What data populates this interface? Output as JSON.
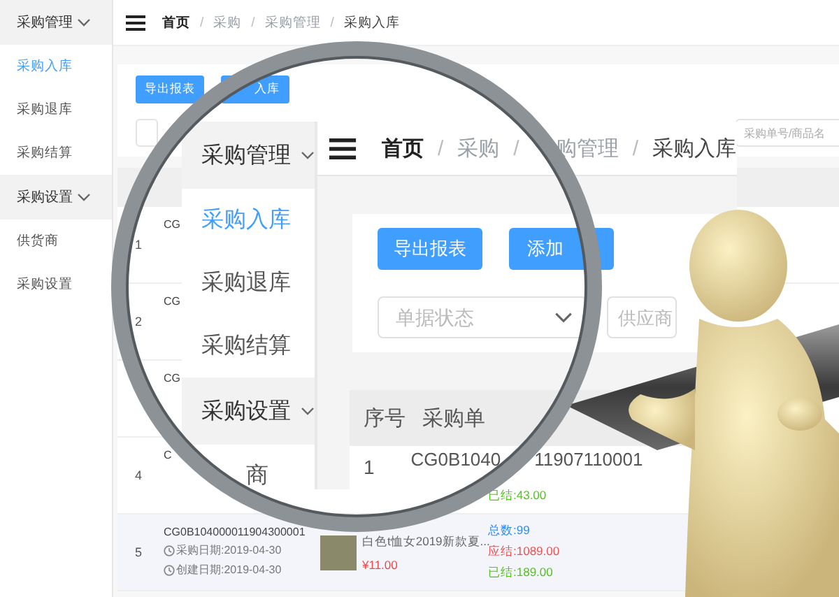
{
  "sidebar": {
    "groups": [
      {
        "label": "采购管理",
        "expanded": true,
        "items": [
          {
            "label": "采购入库",
            "selected": true
          },
          {
            "label": "采购退库",
            "selected": false
          },
          {
            "label": "采购结算",
            "selected": false
          }
        ]
      },
      {
        "label": "采购设置",
        "expanded": true,
        "items": [
          {
            "label": "供货商",
            "selected": false
          },
          {
            "label": "采购设置",
            "selected": false
          }
        ]
      }
    ]
  },
  "breadcrumb": {
    "separator": "/",
    "items": [
      "首页",
      "采购",
      "采购管理",
      "采购入库"
    ]
  },
  "buttons": [
    "导出报表",
    "入库"
  ],
  "search": {
    "placeholder": "采购单号/商品名"
  },
  "table": {
    "rows": [
      {
        "index": "1",
        "order_no": "CG",
        "highlighted": false
      },
      {
        "index": "2",
        "order_no": "CG",
        "highlighted": false
      },
      {
        "order_no": "CG",
        "highlighted": false
      },
      {
        "index": "4",
        "order_no": "C",
        "highlighted": false,
        "totals": [
          {
            "kind": "settled",
            "text": "已结:43.00"
          }
        ]
      },
      {
        "index": "5",
        "order_no": "CG0B104000011904300001",
        "highlighted": true,
        "dates": [
          "采购日期:2019-04-30",
          "创建日期:2019-04-30"
        ],
        "product": {
          "name": "白色t恤女2019新款夏...",
          "price": "¥11.00"
        },
        "totals": [
          {
            "kind": "total",
            "text": "总数:99"
          },
          {
            "kind": "payable",
            "text": "应结:1089.00"
          },
          {
            "kind": "settled",
            "text": "已结:189.00"
          }
        ]
      }
    ]
  },
  "magnifier": {
    "sidebar": {
      "groups": [
        {
          "label": "采购管理",
          "expanded": true,
          "items": [
            {
              "label": "采购入库",
              "selected": true
            },
            {
              "label": "采购退库",
              "selected": false
            },
            {
              "label": "采购结算",
              "selected": false
            }
          ]
        },
        {
          "label": "采购设置",
          "expanded": true,
          "items": [
            {
              "label": "商",
              "selected": false
            }
          ]
        }
      ]
    },
    "breadcrumb": {
      "separator": "/",
      "items": [
        "首页",
        "采购",
        "购管理",
        "采购入库"
      ]
    },
    "buttons": [
      "导出报表",
      "添加"
    ],
    "filters": [
      {
        "kind": "select",
        "placeholder": "单据状态"
      },
      {
        "kind": "text",
        "placeholder": "供应商"
      }
    ],
    "table": {
      "columns": [
        "序号",
        "采购单"
      ],
      "rows": [
        {
          "index": "1",
          "order_no_parts": [
            "CG0B1040",
            "11907110001"
          ]
        }
      ]
    }
  }
}
